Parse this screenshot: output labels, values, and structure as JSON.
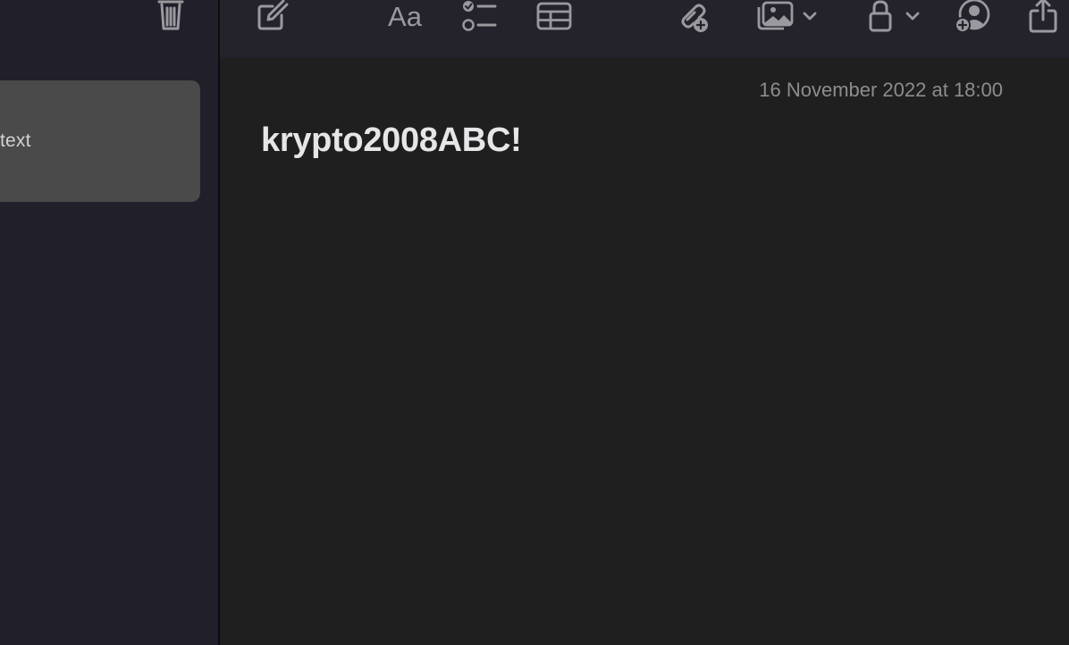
{
  "sidebar": {
    "selected_note_snippet": "text"
  },
  "toolbar": {
    "format_label": "Aa"
  },
  "note": {
    "date": "16 November 2022 at 18:00",
    "title": "krypto2008ABC!"
  },
  "colors": {
    "sidebar_bg": "#211f29",
    "toolbar_bg": "#24222b",
    "editor_bg": "#1f1f1f",
    "selected_card": "#4a4a4b",
    "icon": "#9a999d"
  }
}
